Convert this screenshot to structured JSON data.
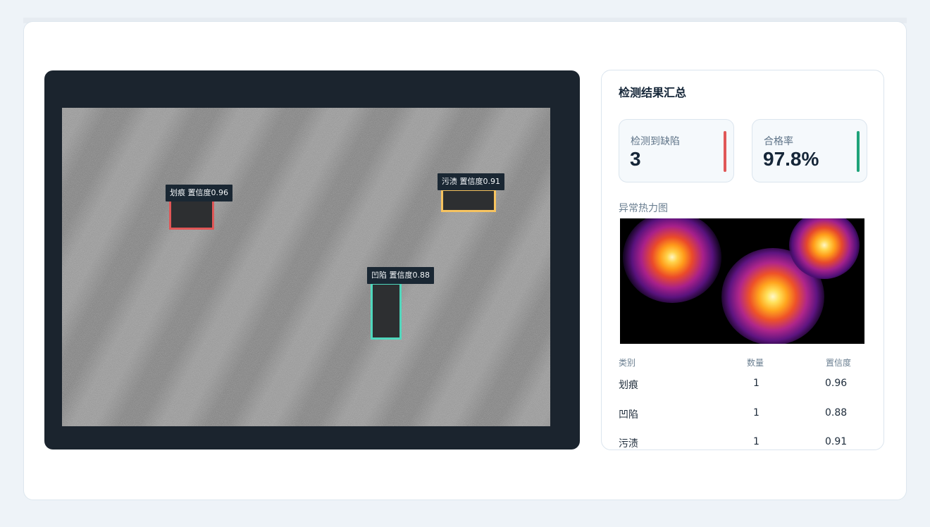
{
  "detections": [
    {
      "label": "划痕 置信度0.96",
      "color": "#e05757"
    },
    {
      "label": "污渍 置信度0.91",
      "color": "#f7c35f"
    },
    {
      "label": "凹陷 置信度0.88",
      "color": "#4fd8bd"
    }
  ],
  "panel": {
    "title": "检测结果汇总",
    "defects_label": "检测到缺陷",
    "defects_value": "3",
    "defects_color": "#e05757",
    "pass_label": "合格率",
    "pass_value": "97.8%",
    "pass_color": "#1fa37a",
    "heatmap_label": "异常热力图",
    "table": {
      "headers": [
        "类别",
        "数量",
        "置信度"
      ],
      "rows": [
        [
          "划痕",
          "1",
          "0.96"
        ],
        [
          "凹陷",
          "1",
          "0.88"
        ],
        [
          "污渍",
          "1",
          "0.91"
        ]
      ]
    }
  }
}
